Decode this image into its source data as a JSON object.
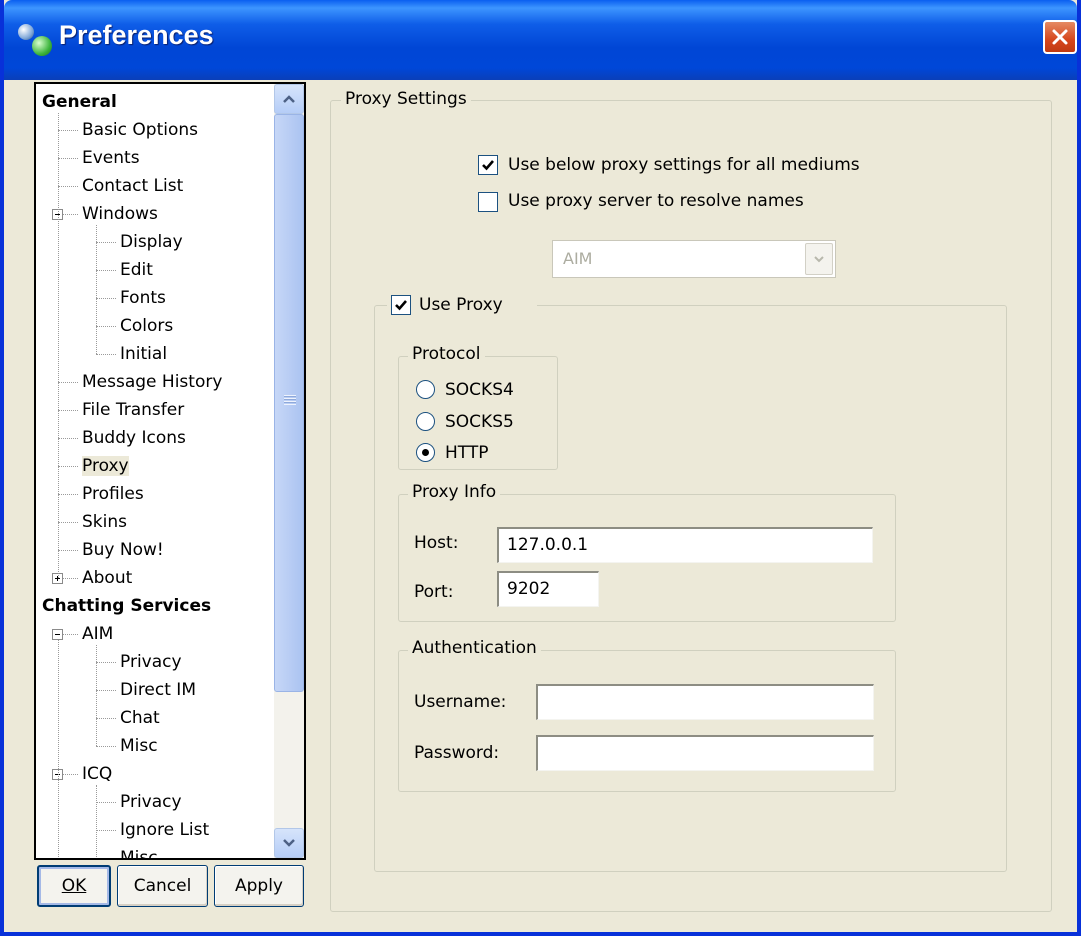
{
  "window": {
    "title": "Preferences",
    "colors": {
      "titlebar": "#0047d8",
      "face": "#ece9d8",
      "close": "#d6461c"
    }
  },
  "tree": {
    "items": [
      {
        "label": "General",
        "bold": true
      },
      {
        "label": "Basic Options"
      },
      {
        "label": "Events"
      },
      {
        "label": "Contact List"
      },
      {
        "label": "Windows",
        "expander": "minus"
      },
      {
        "label": "Display"
      },
      {
        "label": "Edit"
      },
      {
        "label": "Fonts"
      },
      {
        "label": "Colors"
      },
      {
        "label": "Initial"
      },
      {
        "label": "Message History"
      },
      {
        "label": "File Transfer"
      },
      {
        "label": "Buddy Icons"
      },
      {
        "label": "Proxy",
        "selected": true
      },
      {
        "label": "Profiles"
      },
      {
        "label": "Skins"
      },
      {
        "label": "Buy Now!"
      },
      {
        "label": "About",
        "expander": "plus"
      },
      {
        "label": "Chatting Services",
        "bold": true
      },
      {
        "label": "AIM",
        "expander": "minus"
      },
      {
        "label": "Privacy"
      },
      {
        "label": "Direct IM"
      },
      {
        "label": "Chat"
      },
      {
        "label": "Misc"
      },
      {
        "label": "ICQ",
        "expander": "minus"
      },
      {
        "label": "Privacy"
      },
      {
        "label": "Ignore List"
      },
      {
        "label": "Misc"
      }
    ]
  },
  "buttons": {
    "ok": {
      "label": "OK",
      "mnemonic": "O"
    },
    "cancel": {
      "label": "Cancel",
      "mnemonic": "C"
    },
    "apply": {
      "label": "Apply",
      "mnemonic": "A"
    }
  },
  "proxy_settings": {
    "legend": "Proxy Settings",
    "use_all_mediums": {
      "label": "Use below proxy settings for all mediums",
      "checked": true
    },
    "resolve_names": {
      "label": "Use proxy server to resolve names",
      "checked": false
    },
    "medium_select": {
      "value": "AIM",
      "disabled": true
    },
    "use_proxy": {
      "label": "Use Proxy",
      "checked": true
    },
    "protocol": {
      "legend": "Protocol",
      "options": [
        "SOCKS4",
        "SOCKS5",
        "HTTP"
      ],
      "selected": "HTTP"
    },
    "proxy_info": {
      "legend": "Proxy Info",
      "host_label": "Host:",
      "host_value": "127.0.0.1",
      "port_label": "Port:",
      "port_value": "9202"
    },
    "authentication": {
      "legend": "Authentication",
      "username_label": "Username:",
      "username_value": "",
      "password_label": "Password:",
      "password_value": ""
    }
  }
}
